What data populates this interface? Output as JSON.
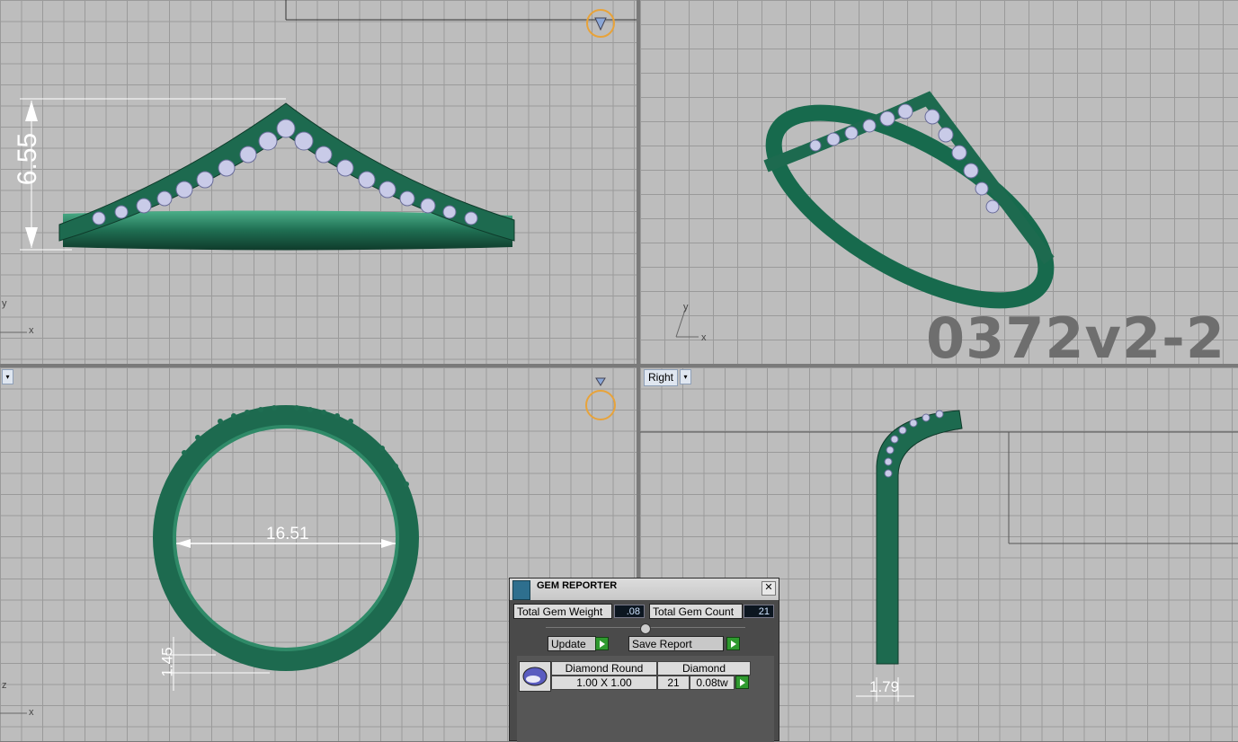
{
  "viewports": {
    "top_left": {
      "axis_y": "y",
      "axis_x": "x",
      "dimension": "6.55"
    },
    "top_right": {
      "axis_y": "y",
      "axis_x": "x",
      "watermark": "0372v2-2"
    },
    "bottom_left": {
      "axis_z": "z",
      "axis_x": "x",
      "dimension_diameter": "16.51",
      "dimension_width": "1.45"
    },
    "bottom_right": {
      "label": "Right",
      "dimension": "1.79"
    }
  },
  "gem_reporter": {
    "title": "GEM REPORTER",
    "close": "✕",
    "total_weight_label": "Total Gem Weight",
    "total_weight_value": ".08",
    "total_count_label": "Total Gem Count",
    "total_count_value": "21",
    "update_button": "Update",
    "save_report_button": "Save Report",
    "table": {
      "header": [
        "Diamond Round",
        "Diamond"
      ],
      "row": {
        "size": "1.00 X 1.00",
        "count": "21",
        "weight": "0.08tw"
      }
    }
  }
}
